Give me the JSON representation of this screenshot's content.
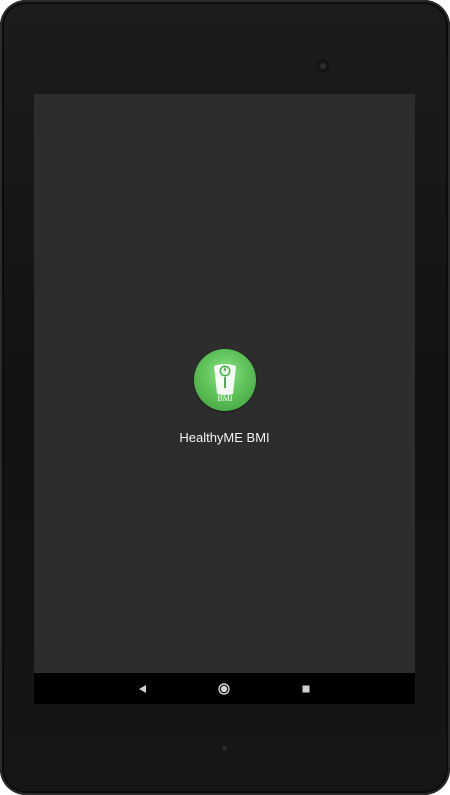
{
  "launcher": {
    "app_name": "HealthyME BMI",
    "icon": "bmi-scale-icon",
    "icon_text": "BMI"
  },
  "navigation": {
    "back_icon": "back-triangle-icon",
    "home_icon": "home-circle-icon",
    "recents_icon": "recents-square-icon"
  },
  "colors": {
    "screen_background": "#2d2d2d",
    "icon_green": "#5fc35a",
    "navbar": "#000000"
  }
}
